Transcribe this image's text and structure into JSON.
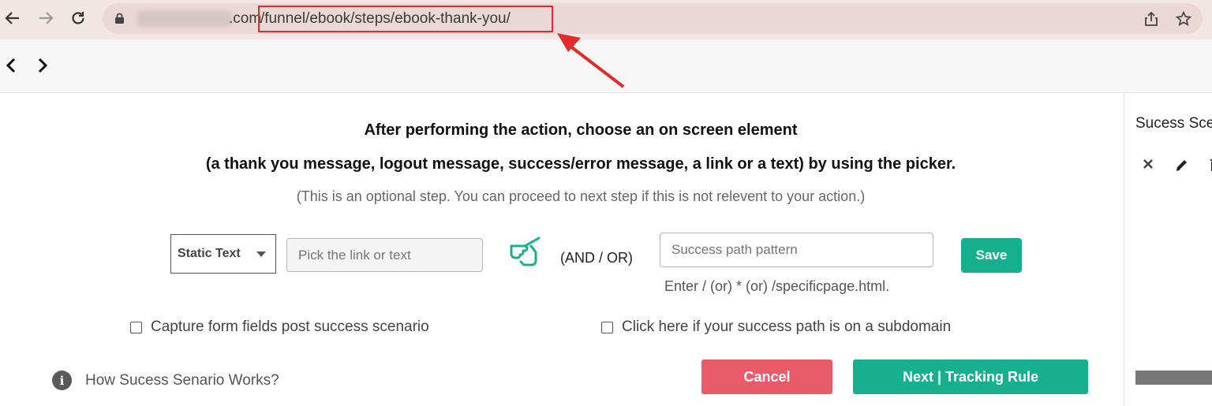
{
  "browser": {
    "url_domain": ".com",
    "url_path": "/funnel/ebook/steps/ebook-thank-you/",
    "icons": [
      "back-arrow-icon",
      "forward-arrow-icon",
      "reload-icon",
      "lock-icon",
      "share-icon",
      "star-icon"
    ]
  },
  "main": {
    "heading_line1": "After performing the action, choose an on screen element",
    "heading_line2": "(a thank you message, logout message, success/error message, a link or a text) by using the picker.",
    "optional_note": "(This is an optional step. You can proceed to next step if this is not relevent to your action.)",
    "element_type_select": "Static Text",
    "pick_placeholder": "Pick the link or text",
    "andor_label": "(AND / OR)",
    "path_placeholder": "Success path pattern",
    "save_label": "Save",
    "path_hint": "Enter / (or) * (or) /specificpage.html.",
    "capture_label": "Capture form fields post success scenario",
    "subdomain_label": "Click here if your success path is on a subdomain",
    "help_link": "How Sucess Senario Works?",
    "cancel_label": "Cancel",
    "next_label": "Next | Tracking Rule"
  },
  "side": {
    "title": "Sucess Sce"
  },
  "colors": {
    "accent_green": "#17b08e",
    "cancel_red": "#ea5b6a",
    "annotation_red": "#e32b2b"
  }
}
